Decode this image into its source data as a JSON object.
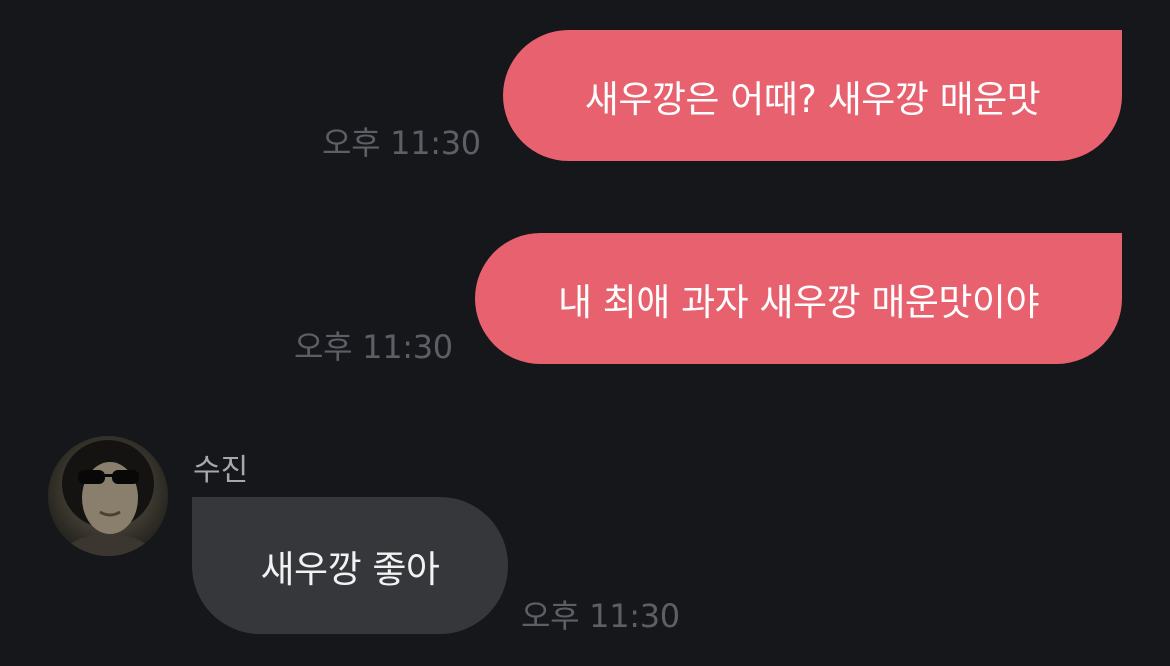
{
  "messages": [
    {
      "direction": "outgoing",
      "text": "새우깡은 어때? 새우깡 매운맛",
      "time": "오후 11:30"
    },
    {
      "direction": "outgoing",
      "text": "내 최애 과자 새우깡 매운맛이야",
      "time": "오후 11:30"
    },
    {
      "direction": "incoming",
      "sender": "수진",
      "text": "새우깡 좋아",
      "time": "오후 11:30"
    }
  ],
  "colors": {
    "background": "#16171b",
    "outgoing_bubble": "#e8616f",
    "incoming_bubble": "#36373b",
    "timestamp": "#5d5f66",
    "sender_name": "#a7a8ad"
  },
  "icons": {
    "avatar": "profile-photo-person-with-sunglasses"
  }
}
